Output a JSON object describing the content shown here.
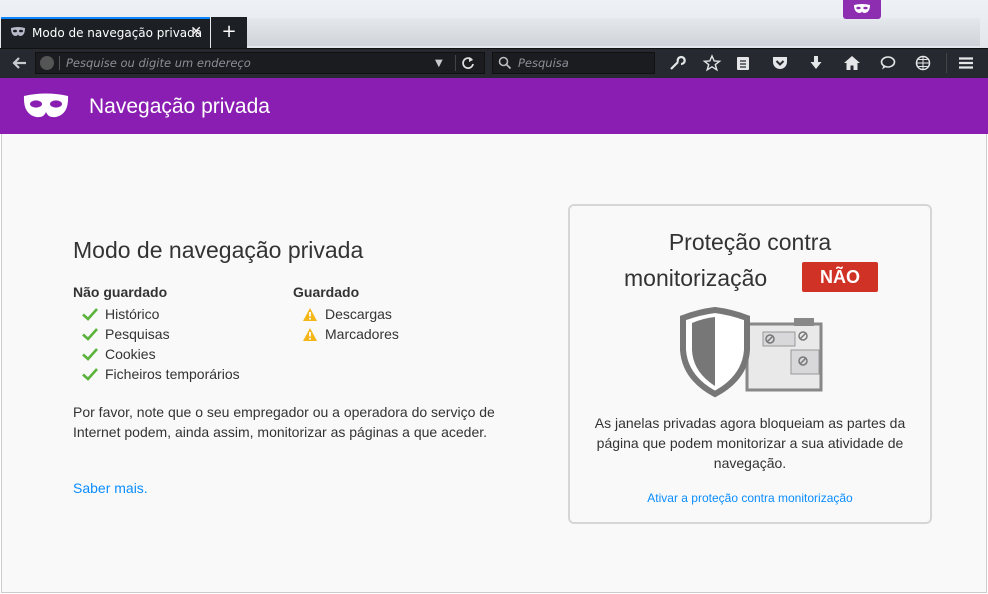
{
  "tab": {
    "title": "Modo de navegação privada",
    "close_glyph": "✕",
    "new_tab_glyph": "+"
  },
  "toolbar": {
    "url_placeholder": "Pesquise ou digite um endereço",
    "search_placeholder": "Pesquisa",
    "icons": [
      "back-icon",
      "globe-icon",
      "dropdown-icon",
      "reload-icon",
      "search-icon",
      "wrench-icon",
      "bookmark-star-icon",
      "reading-list-icon",
      "pocket-icon",
      "download-icon",
      "home-icon",
      "chat-icon",
      "web-icon",
      "menu-icon"
    ]
  },
  "header": {
    "title": "Navegação privada"
  },
  "main": {
    "heading": "Modo de navegação privada",
    "not_saved": {
      "title": "Não guardado",
      "items": [
        "Histórico",
        "Pesquisas",
        "Cookies",
        "Ficheiros temporários"
      ]
    },
    "saved": {
      "title": "Guardado",
      "items": [
        "Descargas",
        "Marcadores"
      ]
    },
    "note": "Por favor, note que o seu empregador ou a operadora do serviço de Internet podem, ainda assim, monitorizar as páginas a que aceder.",
    "learn_more": "Saber mais."
  },
  "tracking_protection": {
    "title_line1": "Proteção contra",
    "title_line2": "monitorização",
    "status": "NÃO",
    "description": "As janelas privadas agora bloqueiam as partes da página que podem monitorizar a sua atividade de navegação.",
    "link": "Ativar a proteção contra monitorização"
  },
  "colors": {
    "private_purple": "#8a1eb2",
    "status_red": "#d13226",
    "link_blue": "#0a8dff",
    "check_green": "#5bb33b",
    "warning_yellow": "#f5b718"
  }
}
